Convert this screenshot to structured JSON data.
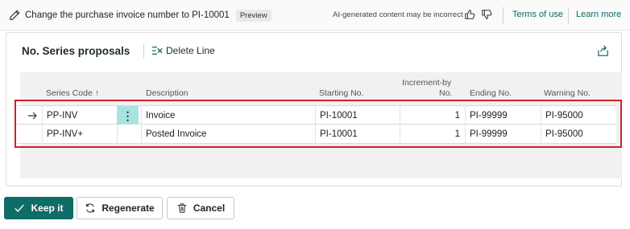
{
  "banner": {
    "prompt": "Change the purchase invoice number to PI-10001",
    "preview_badge": "Preview",
    "ai_note": "AI-generated content may be incorrect",
    "terms_link": "Terms of use",
    "learn_link": "Learn more"
  },
  "card": {
    "title": "No. Series proposals",
    "delete_line": "Delete Line"
  },
  "table": {
    "headers": {
      "series_code": "Series Code ↑",
      "description": "Description",
      "starting_no": "Starting No.",
      "increment_line1": "Increment-by",
      "increment_line2": "No.",
      "ending_no": "Ending No.",
      "warning_no": "Warning No."
    },
    "rows": [
      {
        "series_code": "PP-INV",
        "description": "Invoice",
        "starting_no": "PI-10001",
        "increment": "1",
        "ending_no": "PI-99999",
        "warning_no": "PI-95000"
      },
      {
        "series_code": "PP-INV+",
        "description": "Posted Invoice",
        "starting_no": "PI-10001",
        "increment": "1",
        "ending_no": "PI-99999",
        "warning_no": "PI-95000"
      }
    ]
  },
  "actions": {
    "keep": "Keep it",
    "regenerate": "Regenerate",
    "cancel": "Cancel"
  },
  "colors": {
    "accent": "#0f6c66",
    "highlight_border": "#d21f2d",
    "selected_cell": "#a9e3e0"
  }
}
